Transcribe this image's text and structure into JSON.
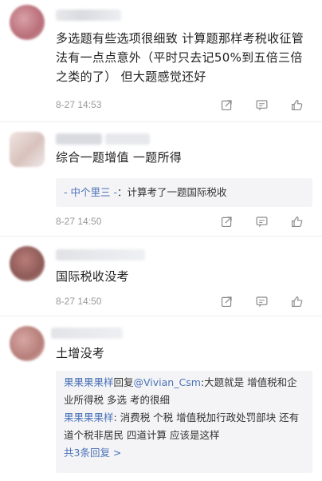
{
  "comments": [
    {
      "text": "多选题有些选项很细致 计算题那样考税收征管法有一点点意外（平时只去记50%到五倍三倍之类的了） 但大题感觉还好",
      "time": "8-27 14:53"
    },
    {
      "text": "综合一题增值 一题所得",
      "time": "8-27 14:50",
      "reply_user": "- 中个里三 -",
      "reply_sep": "：",
      "reply_text": "计算考了一题国际税收"
    },
    {
      "text": "国际税收没考",
      "time": "8-27 14:50"
    },
    {
      "text": "土增没考",
      "replies": [
        {
          "user": "果果果果样",
          "mid": "回复",
          "target": "@Vivian_Csm",
          "text": ":大题就是 增值税和企业所得税 多选 考的很细"
        },
        {
          "user": "果果果果样",
          "mid": "",
          "target": "",
          "text": ": 消费税 个税 增值税加行政处罚部块 还有道个税非居民 四道计算 应该是这样"
        }
      ],
      "more": "共3条回复 >"
    }
  ],
  "icons": [
    "share-icon",
    "comment-icon",
    "like-icon"
  ],
  "colors": {
    "link": "#4a72b8",
    "meta": "#9a9a9a",
    "quote_bg": "#f4f4f6"
  }
}
